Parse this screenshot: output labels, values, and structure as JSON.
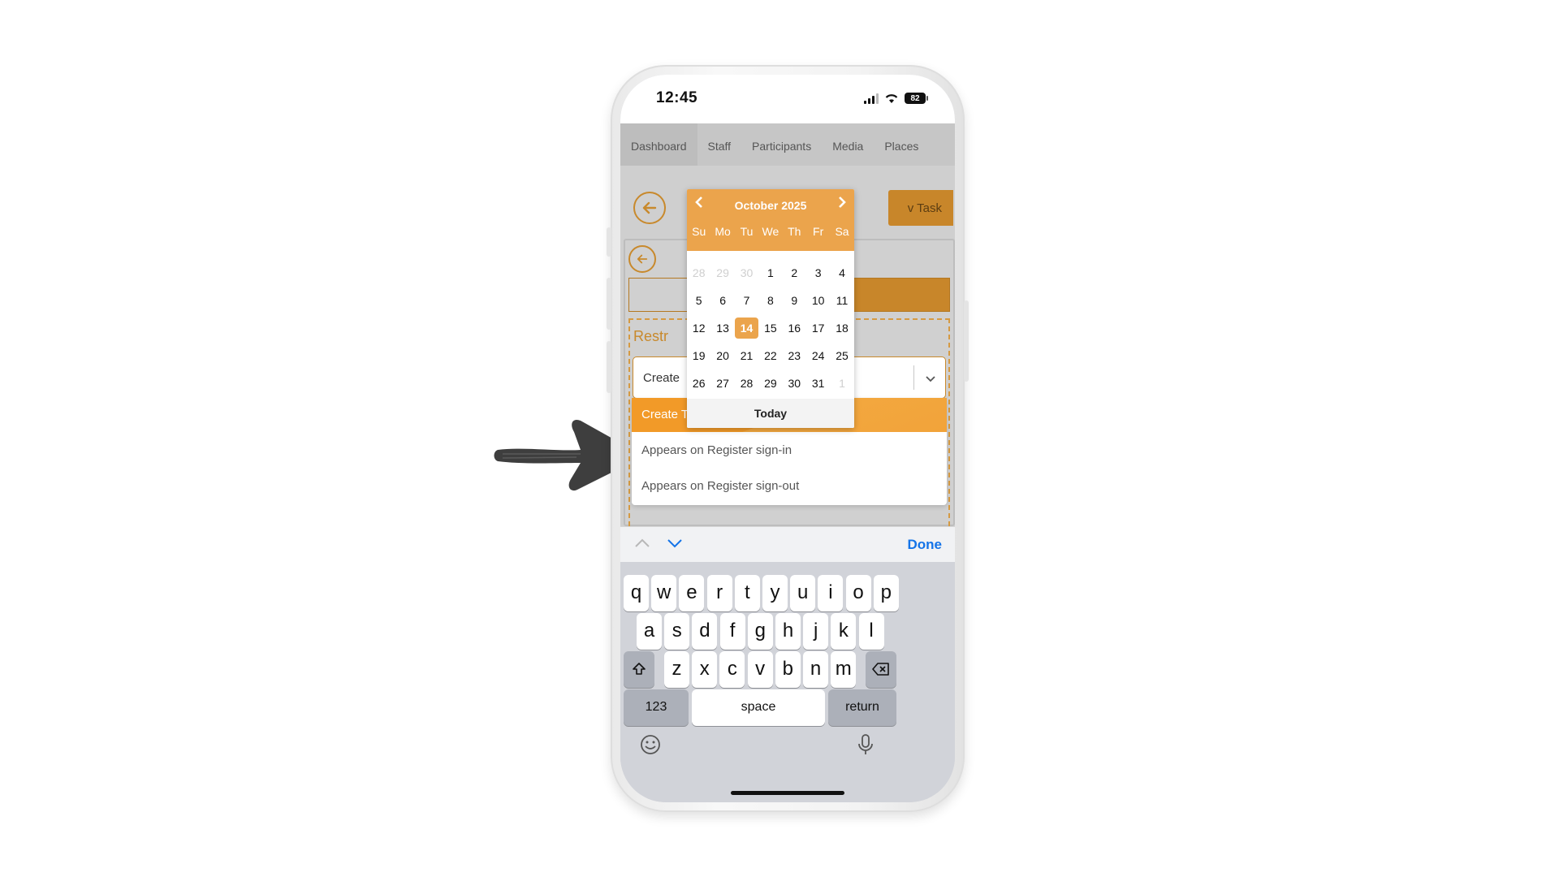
{
  "status_bar": {
    "time": "12:45",
    "battery": "82"
  },
  "tabs": [
    "Dashboard",
    "Staff",
    "Participants",
    "Media",
    "Places"
  ],
  "header": {
    "new_task_label": "v Task"
  },
  "form": {
    "section_label": "Restr",
    "select_value": "Create",
    "options": [
      "Create Task",
      "Appears on Register sign-in",
      "Appears on Register sign-out"
    ]
  },
  "calendar": {
    "title": "October 2025",
    "prev": "‹",
    "next": "›",
    "weekdays": [
      "Su",
      "Mo",
      "Tu",
      "We",
      "Th",
      "Fr",
      "Sa"
    ],
    "weeks": [
      [
        "28",
        "29",
        "30",
        "1",
        "2",
        "3",
        "4"
      ],
      [
        "5",
        "6",
        "7",
        "8",
        "9",
        "10",
        "11"
      ],
      [
        "12",
        "13",
        "14",
        "15",
        "16",
        "17",
        "18"
      ],
      [
        "19",
        "20",
        "21",
        "22",
        "23",
        "24",
        "25"
      ],
      [
        "26",
        "27",
        "28",
        "29",
        "30",
        "31",
        "1"
      ]
    ],
    "selected": "14",
    "today_label": "Today"
  },
  "accessory": {
    "done_label": "Done"
  },
  "keyboard": {
    "row1": [
      "q",
      "w",
      "e",
      "r",
      "t",
      "y",
      "u",
      "i",
      "o",
      "p"
    ],
    "row2": [
      "a",
      "s",
      "d",
      "f",
      "g",
      "h",
      "j",
      "k",
      "l"
    ],
    "row3": [
      "z",
      "x",
      "c",
      "v",
      "b",
      "n",
      "m"
    ],
    "numbers_label": "123",
    "space_label": "space",
    "return_label": "return"
  },
  "colors": {
    "accent": "#eba44c",
    "option_selected": "#f29a28",
    "ios_blue": "#1474e8"
  }
}
